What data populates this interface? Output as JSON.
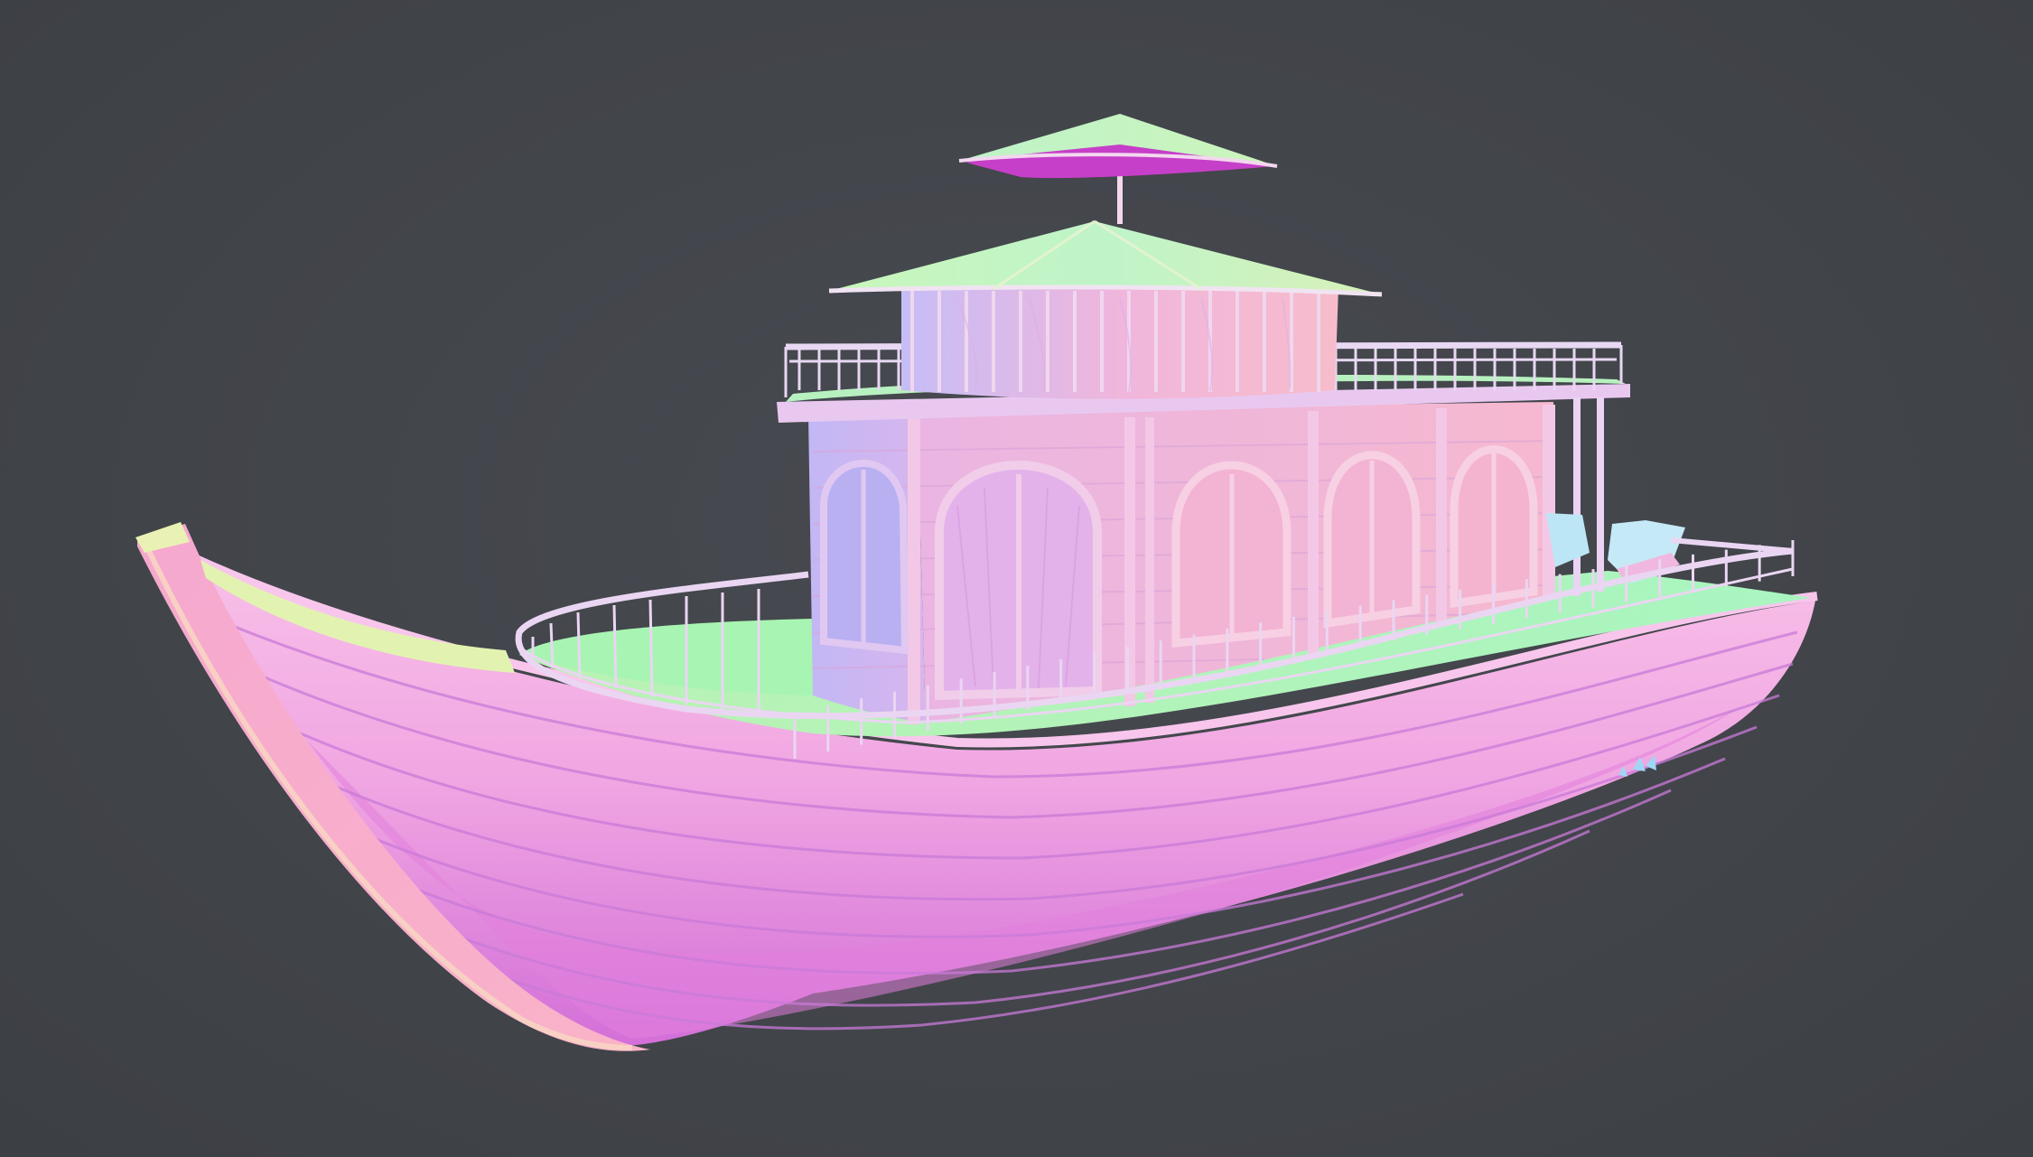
{
  "scene": {
    "subject": "houseboat-3d-model",
    "render_mode": "normal-map-shading",
    "colors": {
      "background": "#414449",
      "hull_light": "#f6b0e6",
      "hull_mid": "#ef9ee0",
      "hull_dark": "#cf72d6",
      "deck": "#aef5b8",
      "cabin_wall_left": "#c9b8f2",
      "cabin_wall_front": "#f2b6da",
      "roof_light": "#c8f7c2",
      "umbrella_top": "#b4f2c6",
      "umbrella_under": "#c63fc8",
      "railing": "#e4d6f2",
      "lounger": "#bde8f6"
    }
  }
}
